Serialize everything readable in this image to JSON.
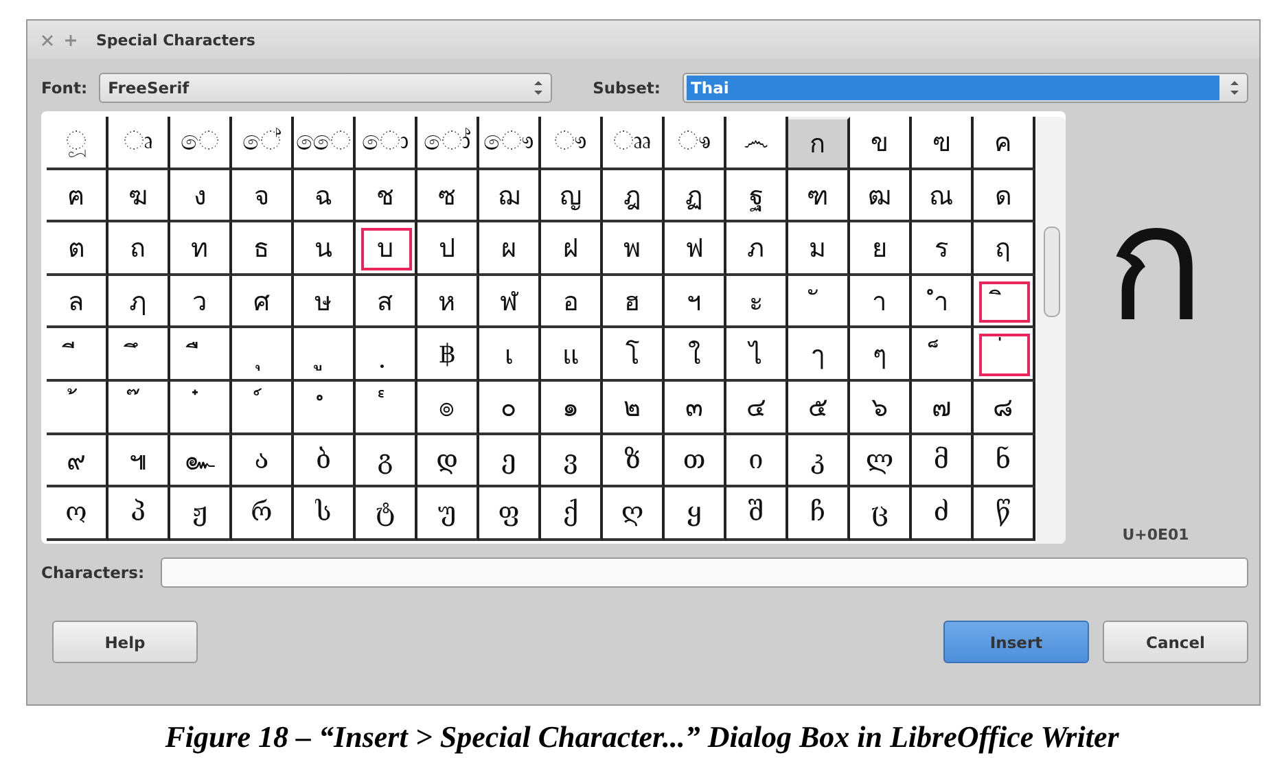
{
  "window": {
    "title": "Special Characters"
  },
  "font": {
    "label": "Font:",
    "value": "FreeSerif"
  },
  "subset": {
    "label": "Subset:",
    "value": "Thai"
  },
  "grid": {
    "rows": [
      [
        {
          "char": "ූ",
          "selected": false,
          "highlighted": false
        },
        {
          "char": "ෘ",
          "selected": false,
          "highlighted": false
        },
        {
          "char": "ෙ",
          "selected": false,
          "highlighted": false
        },
        {
          "char": "ේ",
          "selected": false,
          "highlighted": false
        },
        {
          "char": "ෛ",
          "selected": false,
          "highlighted": false
        },
        {
          "char": "ො",
          "selected": false,
          "highlighted": false
        },
        {
          "char": "ෝ",
          "selected": false,
          "highlighted": false
        },
        {
          "char": "ෞ",
          "selected": false,
          "highlighted": false
        },
        {
          "char": "ෟ",
          "selected": false,
          "highlighted": false
        },
        {
          "char": "ෲ",
          "selected": false,
          "highlighted": false
        },
        {
          "char": "ෳ",
          "selected": false,
          "highlighted": false
        },
        {
          "char": "෴",
          "selected": false,
          "highlighted": false
        },
        {
          "char": "ก",
          "selected": true,
          "highlighted": false
        },
        {
          "char": "ข",
          "selected": false,
          "highlighted": false
        },
        {
          "char": "ฃ",
          "selected": false,
          "highlighted": false
        },
        {
          "char": "ค",
          "selected": false,
          "highlighted": false
        }
      ],
      [
        {
          "char": "ฅ",
          "selected": false,
          "highlighted": false
        },
        {
          "char": "ฆ",
          "selected": false,
          "highlighted": false
        },
        {
          "char": "ง",
          "selected": false,
          "highlighted": false
        },
        {
          "char": "จ",
          "selected": false,
          "highlighted": false
        },
        {
          "char": "ฉ",
          "selected": false,
          "highlighted": false
        },
        {
          "char": "ช",
          "selected": false,
          "highlighted": false
        },
        {
          "char": "ซ",
          "selected": false,
          "highlighted": false
        },
        {
          "char": "ฌ",
          "selected": false,
          "highlighted": false
        },
        {
          "char": "ญ",
          "selected": false,
          "highlighted": false
        },
        {
          "char": "ฎ",
          "selected": false,
          "highlighted": false
        },
        {
          "char": "ฏ",
          "selected": false,
          "highlighted": false
        },
        {
          "char": "ฐ",
          "selected": false,
          "highlighted": false
        },
        {
          "char": "ฑ",
          "selected": false,
          "highlighted": false
        },
        {
          "char": "ฒ",
          "selected": false,
          "highlighted": false
        },
        {
          "char": "ณ",
          "selected": false,
          "highlighted": false
        },
        {
          "char": "ด",
          "selected": false,
          "highlighted": false
        }
      ],
      [
        {
          "char": "ต",
          "selected": false,
          "highlighted": false
        },
        {
          "char": "ถ",
          "selected": false,
          "highlighted": false
        },
        {
          "char": "ท",
          "selected": false,
          "highlighted": false
        },
        {
          "char": "ธ",
          "selected": false,
          "highlighted": false
        },
        {
          "char": "น",
          "selected": false,
          "highlighted": false
        },
        {
          "char": "บ",
          "selected": false,
          "highlighted": true
        },
        {
          "char": "ป",
          "selected": false,
          "highlighted": false
        },
        {
          "char": "ผ",
          "selected": false,
          "highlighted": false
        },
        {
          "char": "ฝ",
          "selected": false,
          "highlighted": false
        },
        {
          "char": "พ",
          "selected": false,
          "highlighted": false
        },
        {
          "char": "ฟ",
          "selected": false,
          "highlighted": false
        },
        {
          "char": "ภ",
          "selected": false,
          "highlighted": false
        },
        {
          "char": "ม",
          "selected": false,
          "highlighted": false
        },
        {
          "char": "ย",
          "selected": false,
          "highlighted": false
        },
        {
          "char": "ร",
          "selected": false,
          "highlighted": false
        },
        {
          "char": "ฤ",
          "selected": false,
          "highlighted": false
        }
      ],
      [
        {
          "char": "ล",
          "selected": false,
          "highlighted": false
        },
        {
          "char": "ฦ",
          "selected": false,
          "highlighted": false
        },
        {
          "char": "ว",
          "selected": false,
          "highlighted": false
        },
        {
          "char": "ศ",
          "selected": false,
          "highlighted": false
        },
        {
          "char": "ษ",
          "selected": false,
          "highlighted": false
        },
        {
          "char": "ส",
          "selected": false,
          "highlighted": false
        },
        {
          "char": "ห",
          "selected": false,
          "highlighted": false
        },
        {
          "char": "ฬ",
          "selected": false,
          "highlighted": false
        },
        {
          "char": "อ",
          "selected": false,
          "highlighted": false
        },
        {
          "char": "ฮ",
          "selected": false,
          "highlighted": false
        },
        {
          "char": "ฯ",
          "selected": false,
          "highlighted": false
        },
        {
          "char": "ะ",
          "selected": false,
          "highlighted": false
        },
        {
          "char": "ั",
          "selected": false,
          "highlighted": false
        },
        {
          "char": "า",
          "selected": false,
          "highlighted": false
        },
        {
          "char": "ำ",
          "selected": false,
          "highlighted": false
        },
        {
          "char": "ิ",
          "selected": false,
          "highlighted": true
        }
      ],
      [
        {
          "char": "ี",
          "selected": false,
          "highlighted": false
        },
        {
          "char": "ึ",
          "selected": false,
          "highlighted": false
        },
        {
          "char": "ื",
          "selected": false,
          "highlighted": false
        },
        {
          "char": "ุ",
          "selected": false,
          "highlighted": false
        },
        {
          "char": "ู",
          "selected": false,
          "highlighted": false
        },
        {
          "char": "ฺ",
          "selected": false,
          "highlighted": false
        },
        {
          "char": "฿",
          "selected": false,
          "highlighted": false
        },
        {
          "char": "เ",
          "selected": false,
          "highlighted": false
        },
        {
          "char": "แ",
          "selected": false,
          "highlighted": false
        },
        {
          "char": "โ",
          "selected": false,
          "highlighted": false
        },
        {
          "char": "ใ",
          "selected": false,
          "highlighted": false
        },
        {
          "char": "ไ",
          "selected": false,
          "highlighted": false
        },
        {
          "char": "ๅ",
          "selected": false,
          "highlighted": false
        },
        {
          "char": "ๆ",
          "selected": false,
          "highlighted": false
        },
        {
          "char": "็",
          "selected": false,
          "highlighted": false
        },
        {
          "char": "่",
          "selected": false,
          "highlighted": true
        }
      ],
      [
        {
          "char": "้",
          "selected": false,
          "highlighted": false
        },
        {
          "char": "๊",
          "selected": false,
          "highlighted": false
        },
        {
          "char": "๋",
          "selected": false,
          "highlighted": false
        },
        {
          "char": "์",
          "selected": false,
          "highlighted": false
        },
        {
          "char": "ํ",
          "selected": false,
          "highlighted": false
        },
        {
          "char": "๎",
          "selected": false,
          "highlighted": false
        },
        {
          "char": "๏",
          "selected": false,
          "highlighted": false
        },
        {
          "char": "๐",
          "selected": false,
          "highlighted": false
        },
        {
          "char": "๑",
          "selected": false,
          "highlighted": false
        },
        {
          "char": "๒",
          "selected": false,
          "highlighted": false
        },
        {
          "char": "๓",
          "selected": false,
          "highlighted": false
        },
        {
          "char": "๔",
          "selected": false,
          "highlighted": false
        },
        {
          "char": "๕",
          "selected": false,
          "highlighted": false
        },
        {
          "char": "๖",
          "selected": false,
          "highlighted": false
        },
        {
          "char": "๗",
          "selected": false,
          "highlighted": false
        },
        {
          "char": "๘",
          "selected": false,
          "highlighted": false
        }
      ],
      [
        {
          "char": "๙",
          "selected": false,
          "highlighted": false
        },
        {
          "char": "๚",
          "selected": false,
          "highlighted": false
        },
        {
          "char": "๛",
          "selected": false,
          "highlighted": false
        },
        {
          "char": "ა",
          "selected": false,
          "highlighted": false
        },
        {
          "char": "ბ",
          "selected": false,
          "highlighted": false
        },
        {
          "char": "გ",
          "selected": false,
          "highlighted": false
        },
        {
          "char": "დ",
          "selected": false,
          "highlighted": false
        },
        {
          "char": "ე",
          "selected": false,
          "highlighted": false
        },
        {
          "char": "ვ",
          "selected": false,
          "highlighted": false
        },
        {
          "char": "ზ",
          "selected": false,
          "highlighted": false
        },
        {
          "char": "თ",
          "selected": false,
          "highlighted": false
        },
        {
          "char": "ი",
          "selected": false,
          "highlighted": false
        },
        {
          "char": "კ",
          "selected": false,
          "highlighted": false
        },
        {
          "char": "ლ",
          "selected": false,
          "highlighted": false
        },
        {
          "char": "მ",
          "selected": false,
          "highlighted": false
        },
        {
          "char": "ნ",
          "selected": false,
          "highlighted": false
        }
      ],
      [
        {
          "char": "ო",
          "selected": false,
          "highlighted": false
        },
        {
          "char": "პ",
          "selected": false,
          "highlighted": false
        },
        {
          "char": "ჟ",
          "selected": false,
          "highlighted": false
        },
        {
          "char": "რ",
          "selected": false,
          "highlighted": false
        },
        {
          "char": "ს",
          "selected": false,
          "highlighted": false
        },
        {
          "char": "ტ",
          "selected": false,
          "highlighted": false
        },
        {
          "char": "უ",
          "selected": false,
          "highlighted": false
        },
        {
          "char": "ფ",
          "selected": false,
          "highlighted": false
        },
        {
          "char": "ქ",
          "selected": false,
          "highlighted": false
        },
        {
          "char": "ღ",
          "selected": false,
          "highlighted": false
        },
        {
          "char": "ყ",
          "selected": false,
          "highlighted": false
        },
        {
          "char": "შ",
          "selected": false,
          "highlighted": false
        },
        {
          "char": "ჩ",
          "selected": false,
          "highlighted": false
        },
        {
          "char": "ც",
          "selected": false,
          "highlighted": false
        },
        {
          "char": "ძ",
          "selected": false,
          "highlighted": false
        },
        {
          "char": "წ",
          "selected": false,
          "highlighted": false
        }
      ]
    ]
  },
  "preview": {
    "char": "ก",
    "code": "U+0E01"
  },
  "characters": {
    "label": "Characters:"
  },
  "buttons": [
    {
      "label": "Help",
      "kind": "normal"
    },
    {
      "label": "Insert",
      "kind": "default"
    },
    {
      "label": "Cancel",
      "kind": "normal"
    }
  ],
  "caption": "Figure 18 – “Insert > Special Character...” Dialog Box in LibreOffice Writer"
}
